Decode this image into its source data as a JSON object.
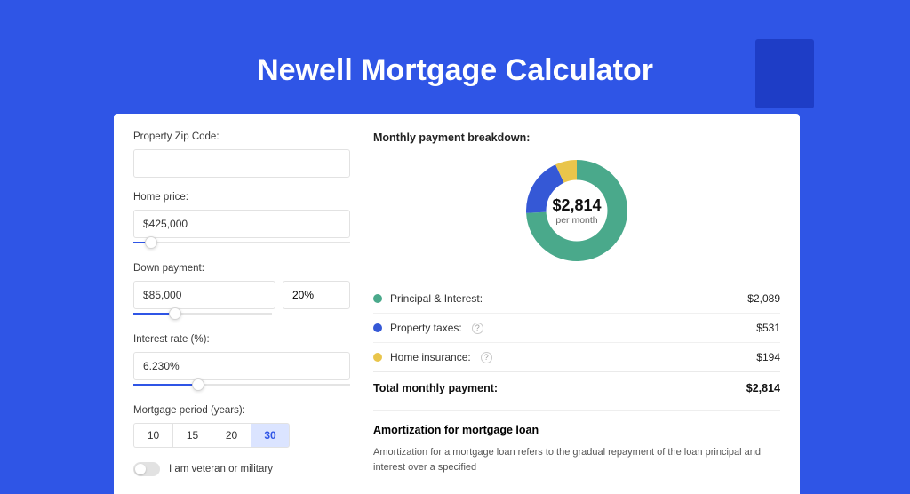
{
  "title": "Newell Mortgage Calculator",
  "colors": {
    "principal": "#4aa98b",
    "taxes": "#3558d6",
    "insurance": "#e9c54b"
  },
  "form": {
    "zip_label": "Property Zip Code:",
    "zip_value": "",
    "home_price_label": "Home price:",
    "home_price_value": "$425,000",
    "home_price_slider_pct": 8,
    "down_label": "Down payment:",
    "down_value": "$85,000",
    "down_pct_value": "20%",
    "down_slider_pct": 20,
    "rate_label": "Interest rate (%):",
    "rate_value": "6.230%",
    "rate_slider_pct": 30,
    "period_label": "Mortgage period (years):",
    "periods": [
      "10",
      "15",
      "20",
      "30"
    ],
    "period_active_index": 3,
    "veteran_label": "I am veteran or military",
    "veteran_on": false
  },
  "breakdown": {
    "title": "Monthly payment breakdown:",
    "center_amount": "$2,814",
    "center_label": "per month",
    "items": [
      {
        "label": "Principal & Interest:",
        "value": "$2,089",
        "color_key": "principal",
        "tooltip": false,
        "num": 2089
      },
      {
        "label": "Property taxes:",
        "value": "$531",
        "color_key": "taxes",
        "tooltip": true,
        "num": 531
      },
      {
        "label": "Home insurance:",
        "value": "$194",
        "color_key": "insurance",
        "tooltip": true,
        "num": 194
      }
    ],
    "total_label": "Total monthly payment:",
    "total_value": "$2,814"
  },
  "amortization": {
    "title": "Amortization for mortgage loan",
    "text": "Amortization for a mortgage loan refers to the gradual repayment of the loan principal and interest over a specified"
  },
  "chart_data": {
    "type": "pie",
    "title": "Monthly payment breakdown",
    "series": [
      {
        "name": "Principal & Interest",
        "value": 2089,
        "color": "#4aa98b"
      },
      {
        "name": "Property taxes",
        "value": 531,
        "color": "#3558d6"
      },
      {
        "name": "Home insurance",
        "value": 194,
        "color": "#e9c54b"
      }
    ],
    "total": 2814,
    "center_label": "$2,814 per month"
  }
}
